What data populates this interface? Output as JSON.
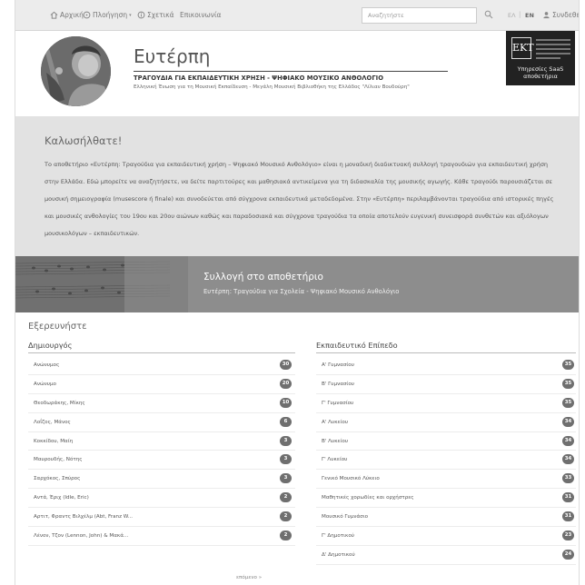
{
  "nav": {
    "home": "Αρχική",
    "browse": "Πλοήγηση",
    "about": "Σχετικά",
    "contact": "Επικοινωνία",
    "search_placeholder": "Αναζητήστε",
    "lang_el": "ΕΛ",
    "lang_separator": "|",
    "lang_en": "EN",
    "login": "Συνδεθείτε"
  },
  "header": {
    "title": "Ευτέρπη",
    "subtitle": "ΤΡΑΓΟΥΔΙΑ ΓΙΑ ΕΚΠΑΙΔΕΥΤΙΚΗ ΧΡΗΣΗ - ΨΗΦΙΑΚΟ ΜΟΥΣΙΚΟ ΑΝΘΟΛΟΓΙΟ",
    "tagline": "Ελληνική Ένωση για τη Μουσική Εκπαίδευση - Μεγάλη Μουσική Βιβλιοθήκη της Ελλάδος \"Λίλιαν Βουδούρη\"",
    "logo_mark": "ΕΚΤ",
    "logo_services_line1": "Υπηρεσίες SaaS",
    "logo_services_line2": "αποθετήρια"
  },
  "welcome": {
    "heading": "Καλωσήλθατε!",
    "text": "Το αποθετήριο «Ευτέρπη: Τραγούδια για εκπαιδευτική χρήση – Ψηφιακό Μουσικό Ανθολόγιο» είναι η μοναδική διαδικτυακή συλλογή τραγουδιών για εκπαιδευτική χρήση στην Ελλάδα. Εδώ μπορείτε να αναζητήσετε, να δείτε παρτιτούρες και μαθησιακά αντικείμενα για τη διδασκαλία της μουσικής αγωγής. Κάθε τραγούδι παρουσιάζεται σε μουσική σημειογραφία (musescore ή finale) και συνοδεύεται από σύγχρονα εκπαιδευτικά μεταδεδομένα. Στην «Ευτέρπη» περιλαμβάνονται τραγούδια από ιστορικές πηγές και μουσικές ανθολογίες του 19ου και 20ου αιώνων καθώς και παραδοσιακά και σύγχρονα τραγούδια τα οποία αποτελούν ευγενική συνεισφορά συνθετών και αξιόλογων μουσικολόγων – εκπαιδευτικών."
  },
  "banner": {
    "title": "Συλλογή στο αποθετήριο",
    "subtitle": "Ευτέρπη: Τραγούδια για Σχολεία - Ψηφιακό Μουσικό Ανθολόγιο"
  },
  "explore": {
    "heading": "Εξερευνήστε",
    "creators": {
      "heading": "Δημιουργός",
      "items": [
        {
          "label": "Ανώνυμος",
          "count": "30"
        },
        {
          "label": "Ανώνυμο",
          "count": "20"
        },
        {
          "label": "Θεοδωράκης, Μίκης",
          "count": "10"
        },
        {
          "label": "Λοΐζος, Μάνος",
          "count": "6"
        },
        {
          "label": "Κοκκίδου, Μαίη",
          "count": "3"
        },
        {
          "label": "Μαυρουδής, Νότης",
          "count": "3"
        },
        {
          "label": "Σαρχόκος, Σπύρος",
          "count": "3"
        },
        {
          "label": "Αντά, Έριχ (Idle, Eric)",
          "count": "2"
        },
        {
          "label": "Αρτιτ, Φραντς Βιλχέλμ (Abt, Franz W...",
          "count": "2"
        },
        {
          "label": "Λένον, Τζον (Lennon, John) & Μακά...",
          "count": "2"
        }
      ],
      "next": "επόμενο »"
    },
    "levels": {
      "heading": "Εκπαιδευτικό Επίπεδο",
      "items": [
        {
          "label": "Α' Γυμνασίου",
          "count": "35"
        },
        {
          "label": "Β' Γυμνασίου",
          "count": "35"
        },
        {
          "label": "Γ' Γυμνασίου",
          "count": "35"
        },
        {
          "label": "Α' Λυκείου",
          "count": "34"
        },
        {
          "label": "Β' Λυκείου",
          "count": "34"
        },
        {
          "label": "Γ' Λυκείου",
          "count": "34"
        },
        {
          "label": "Γενικό Μουσικό Λύκειο",
          "count": "33"
        },
        {
          "label": "Μαθητικές χορωδίες και ορχήστρες",
          "count": "31"
        },
        {
          "label": "Μουσικό Γυμνάσιο",
          "count": "31"
        },
        {
          "label": "Γ' Δημοτικού",
          "count": "23"
        },
        {
          "label": "Δ' Δημοτικού",
          "count": "24"
        }
      ]
    }
  }
}
